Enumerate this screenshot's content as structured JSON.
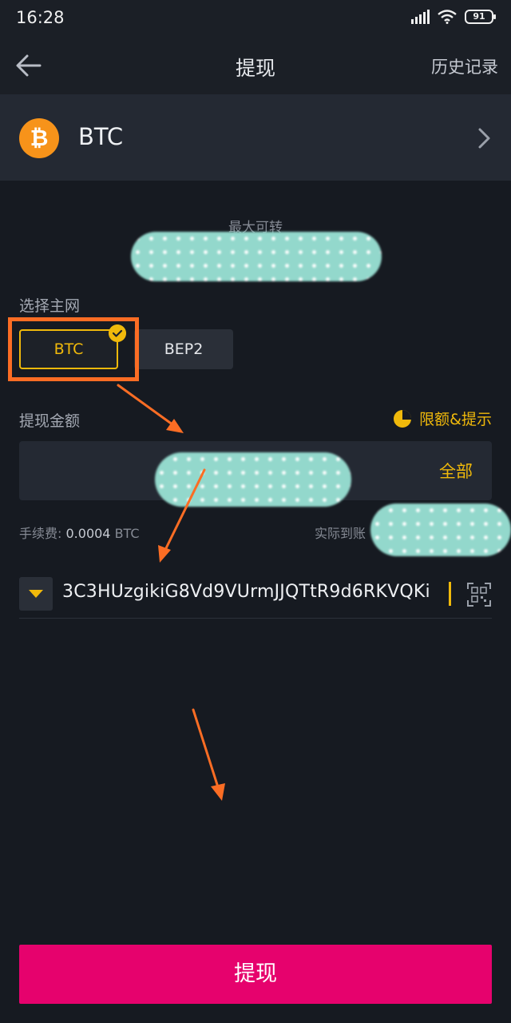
{
  "status_bar": {
    "time": "16:28",
    "battery": "91"
  },
  "header": {
    "title": "提现",
    "history_label": "历史记录"
  },
  "coin": {
    "symbol_glyph": "₿",
    "name": "BTC",
    "icon_color": "#f7931a"
  },
  "balance": {
    "max_label": "最大可转"
  },
  "network": {
    "label": "选择主网",
    "options": [
      "BTC",
      "BEP2"
    ],
    "selected": "BTC"
  },
  "amount": {
    "label": "提现金额",
    "limits_label": "限额&提示",
    "all_label": "全部"
  },
  "fee": {
    "label": "手续费:",
    "value": "0.0004",
    "unit": "BTC"
  },
  "received": {
    "label": "实际到账"
  },
  "address": {
    "value": "3C3HUzgikiG8Vd9VUrmJJQTtR9d6RKVQKi"
  },
  "submit_label": "提现",
  "colors": {
    "accent": "#f0b90b",
    "submit": "#e6026d",
    "annotation": "#fb6d24"
  }
}
